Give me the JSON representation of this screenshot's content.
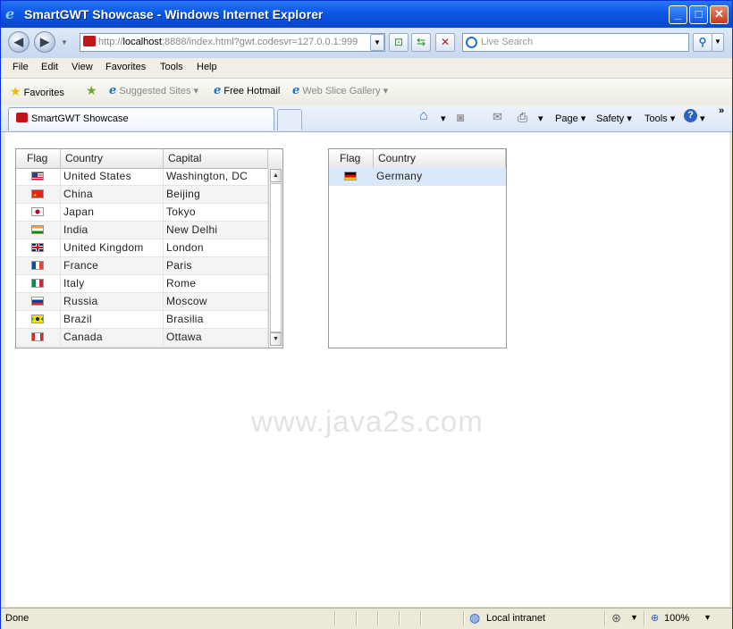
{
  "window": {
    "title": "SmartGWT Showcase - Windows Internet Explorer",
    "minimize_glyph": "_",
    "maximize_glyph": "□",
    "close_glyph": "✕"
  },
  "address": {
    "url_prefix": "http://",
    "url_host": "localhost",
    "url_rest": ":8888/index.html?gwt.codesvr=127.0.0.1:999",
    "search_placeholder": "Live Search"
  },
  "menu": [
    "File",
    "Edit",
    "View",
    "Favorites",
    "Tools",
    "Help"
  ],
  "favorites": {
    "favorites_label": "Favorites",
    "suggested": "Suggested Sites",
    "hotmail": "Free Hotmail",
    "gallery": "Web Slice Gallery"
  },
  "tab": {
    "label": "SmartGWT Showcase"
  },
  "commands": {
    "page": "Page",
    "safety": "Safety",
    "tools": "Tools"
  },
  "watermark": "www.java2s.com",
  "left_grid": {
    "headers": {
      "flag": "Flag",
      "country": "Country",
      "capital": "Capital"
    },
    "rows": [
      {
        "country": "United States",
        "capital": "Washington, DC",
        "flag": "us"
      },
      {
        "country": "China",
        "capital": "Beijing",
        "flag": "cn"
      },
      {
        "country": "Japan",
        "capital": "Tokyo",
        "flag": "jp"
      },
      {
        "country": "India",
        "capital": "New Delhi",
        "flag": "in"
      },
      {
        "country": "United Kingdom",
        "capital": "London",
        "flag": "gb"
      },
      {
        "country": "France",
        "capital": "Paris",
        "flag": "fr"
      },
      {
        "country": "Italy",
        "capital": "Rome",
        "flag": "it"
      },
      {
        "country": "Russia",
        "capital": "Moscow",
        "flag": "ru"
      },
      {
        "country": "Brazil",
        "capital": "Brasilia",
        "flag": "br"
      },
      {
        "country": "Canada",
        "capital": "Ottawa",
        "flag": "ca"
      }
    ]
  },
  "right_grid": {
    "headers": {
      "flag": "Flag",
      "country": "Country"
    },
    "rows": [
      {
        "country": "Germany",
        "flag": "de"
      }
    ]
  },
  "status": {
    "text": "Done",
    "zone": "Local intranet",
    "zoom": "100%"
  }
}
